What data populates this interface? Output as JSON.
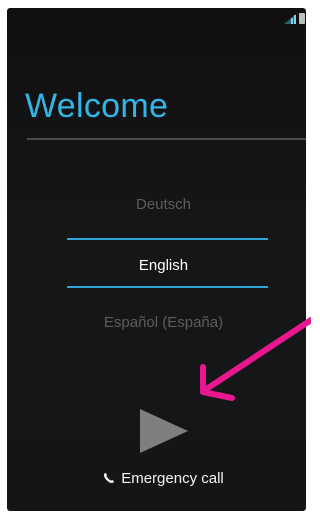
{
  "title": "Welcome",
  "languages": [
    "Deutsch",
    "English",
    "Español (España)"
  ],
  "selected_language": "English",
  "emergency_call_label": "Emergency call",
  "icons": {
    "status": "signal-icon",
    "battery": "battery-icon",
    "next": "play-triangle-icon",
    "phone": "phone-icon",
    "annotation": "arrow-icon"
  },
  "colors": {
    "accent": "#33b5e5",
    "selected_line": "#2fa6d6",
    "annotation_arrow": "#e8178f"
  }
}
